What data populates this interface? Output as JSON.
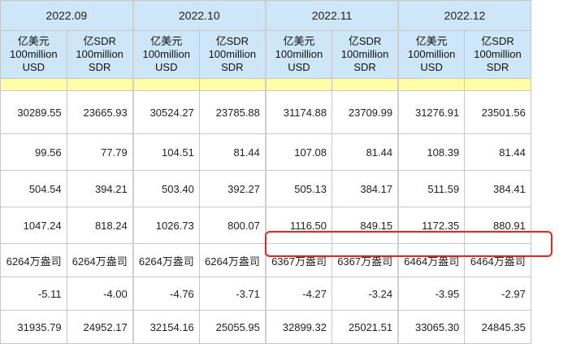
{
  "periods": [
    "2022.09",
    "2022.10",
    "2022.11",
    "2022.12"
  ],
  "units": {
    "usd": [
      "亿美元",
      "100million",
      "USD"
    ],
    "sdr": [
      "亿SDR",
      "100million",
      "SDR"
    ]
  },
  "rows": [
    [
      "30289.55",
      "23665.93",
      "30524.27",
      "23785.88",
      "31174.88",
      "23709.99",
      "31276.91",
      "23501.56"
    ],
    [
      "99.56",
      "77.79",
      "104.51",
      "81.44",
      "107.08",
      "81.44",
      "108.39",
      "81.44"
    ],
    [
      "504.54",
      "394.21",
      "503.40",
      "392.27",
      "505.13",
      "384.17",
      "511.59",
      "384.41"
    ],
    [
      "1047.24",
      "818.24",
      "1026.73",
      "800.07",
      "1116.50",
      "849.15",
      "1172.35",
      "880.91"
    ],
    [
      "6264万盎司",
      "6264万盎司",
      "6264万盎司",
      "6264万盎司",
      "6367万盎司",
      "6367万盎司",
      "6464万盎司",
      "6464万盎司"
    ],
    [
      "-5.11",
      "-4.00",
      "-4.76",
      "-3.71",
      "-4.27",
      "-3.24",
      "-3.95",
      "-2.97"
    ],
    [
      "31935.79",
      "24952.17",
      "32154.16",
      "25055.95",
      "32899.32",
      "25021.51",
      "33065.30",
      "24845.35"
    ]
  ],
  "highlight_color": "#e0261f"
}
